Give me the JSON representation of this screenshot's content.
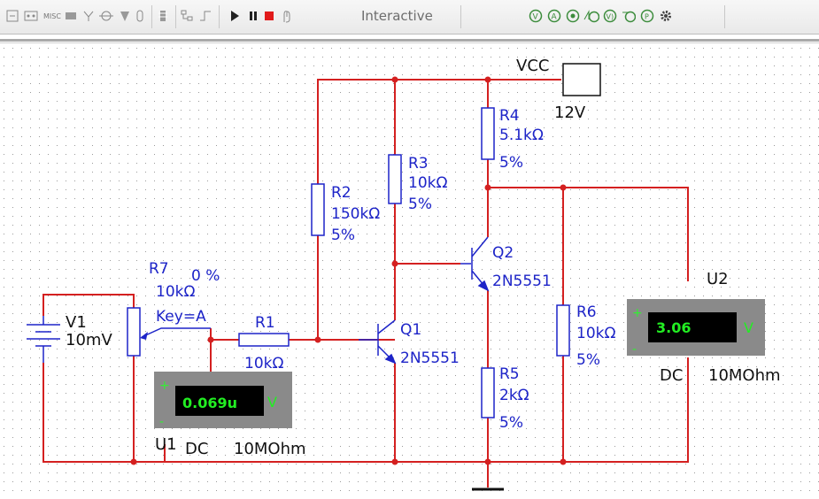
{
  "toolbar": {
    "interactive_label": "Interactive",
    "left_icons": [
      "component-bin-icon",
      "connector-icon",
      "misc-icon",
      "indicator-icon",
      "antenna-icon",
      "probe-icon",
      "transistor-icon",
      "capacitor-icon",
      "bus-icon",
      "hierarchy-icon",
      "wire-icon"
    ],
    "misc_text": "MISC",
    "instrument_icons": [
      "multimeter-icon",
      "ammeter-icon",
      "wattmeter-icon",
      "oscilloscope-icon",
      "voltmeter-icon",
      "probe-tool-icon",
      "frequency-icon",
      "settings-gear-icon"
    ]
  },
  "circuit": {
    "vcc": {
      "name": "VCC",
      "value": "12V"
    },
    "v1": {
      "name": "V1",
      "value": "10mV"
    },
    "r1": {
      "name": "R1",
      "value": "10kΩ"
    },
    "r2": {
      "name": "R2",
      "value": "150kΩ",
      "tol": "5%"
    },
    "r3": {
      "name": "R3",
      "value": "10kΩ",
      "tol": "5%"
    },
    "r4": {
      "name": "R4",
      "value": "5.1kΩ",
      "tol": "5%"
    },
    "r5": {
      "name": "R5",
      "value": "2kΩ",
      "tol": "5%"
    },
    "r6": {
      "name": "R6",
      "value": "10kΩ",
      "tol": "5%"
    },
    "r7": {
      "name": "R7",
      "percent": "0 %",
      "value": "10kΩ",
      "key": "Key=A"
    },
    "q1": {
      "name": "Q1",
      "model": "2N5551"
    },
    "q2": {
      "name": "Q2",
      "model": "2N5551"
    },
    "u1": {
      "name": "U1",
      "reading": "0.069u",
      "unit": "V",
      "mode": "DC",
      "impedance": "10MOhm",
      "plus": "+",
      "minus": "-"
    },
    "u2": {
      "name": "U2",
      "reading": "3.06",
      "unit": "V",
      "mode": "DC",
      "impedance": "10MOhm",
      "plus": "+",
      "minus": "-"
    }
  },
  "colors": {
    "wire": "#d42020",
    "label": "#1d24c8",
    "meter_body": "#8a8a8a",
    "meter_display": "#000000",
    "meter_text": "#22ee22"
  }
}
